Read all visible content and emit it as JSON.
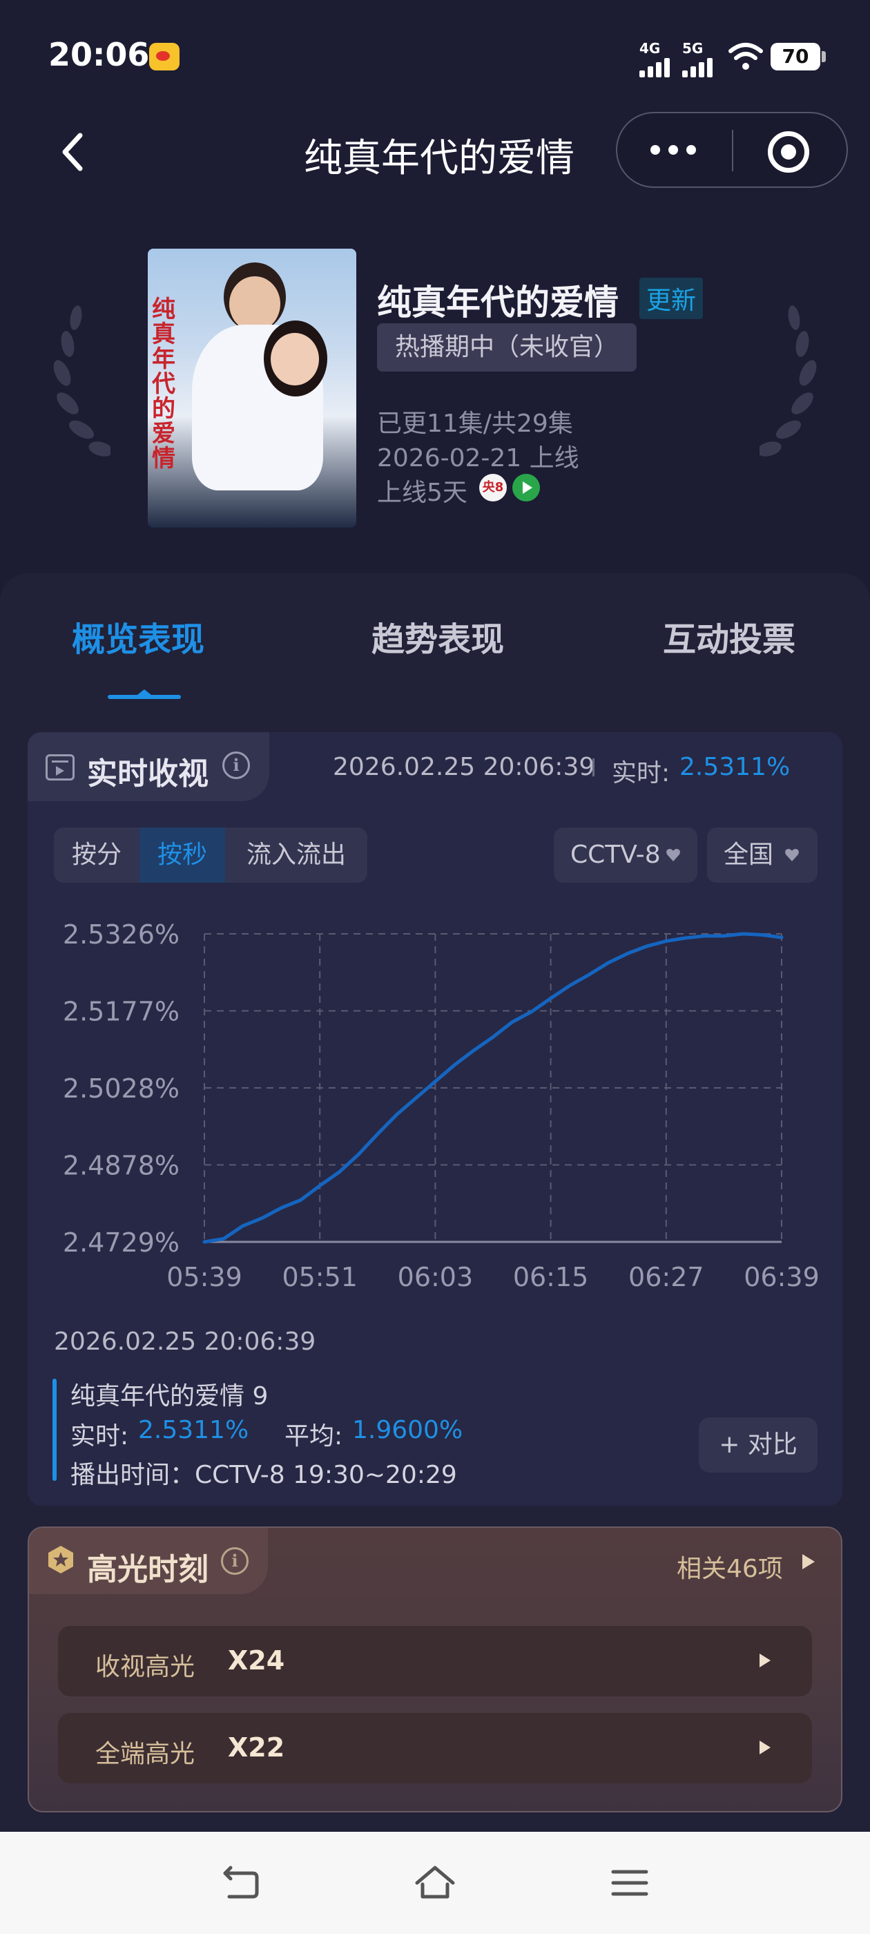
{
  "status_bar": {
    "time": "20:06",
    "network_1": "4G",
    "network_2": "5G",
    "battery": "70"
  },
  "nav": {
    "title": "纯真年代的爱情",
    "back_icon": "chevron-left-icon",
    "more_icon": "more-dots-icon",
    "close_icon": "target-icon"
  },
  "show": {
    "poster_title": "纯真年代的爱情",
    "title": "纯真年代的爱情",
    "update_badge": "更新",
    "status": "热播期中（未收官）",
    "episodes": "已更11集/共29集",
    "premiere": "2026-02-21 上线",
    "days_online": "上线5天",
    "platform_badge": "央8"
  },
  "tabs": [
    {
      "label": "概览表现",
      "active": true
    },
    {
      "label": "趋势表现",
      "active": false
    },
    {
      "label": "互动投票",
      "active": false
    }
  ],
  "realtime": {
    "title": "实时收视",
    "info_glyph": "i",
    "datetime": "2026.02.25 20:06:39",
    "live_label": "实时:",
    "live_value": "2.5311%",
    "segments": [
      "按分",
      "按秒",
      "流入流出"
    ],
    "selected_segment": "按秒",
    "channel": "CCTV-8",
    "region": "全国"
  },
  "chart_data": {
    "type": "line",
    "title": "",
    "xlabel": "",
    "ylabel": "",
    "y_ticks": [
      "2.5326%",
      "2.5177%",
      "2.5028%",
      "2.4878%",
      "2.4729%"
    ],
    "x_ticks": [
      "05:39",
      "05:51",
      "06:03",
      "06:15",
      "06:27",
      "06:39"
    ],
    "ylim": [
      2.4729,
      2.5326
    ],
    "x_unit": "seconds since 20:05:39",
    "grid": true,
    "line_color": "#1565c0",
    "series": [
      {
        "x": [
          0,
          2,
          4,
          6,
          8,
          10,
          12,
          14,
          16,
          18,
          20,
          22,
          24,
          26,
          28,
          30,
          32,
          34,
          36,
          38,
          40,
          42,
          44,
          46,
          48,
          50,
          52,
          54,
          56,
          58,
          60
        ],
        "values": [
          2.4729,
          2.4735,
          2.476,
          2.4775,
          2.4795,
          2.481,
          2.4838,
          2.4864,
          2.4898,
          2.4938,
          2.4976,
          2.5008,
          2.504,
          2.5072,
          2.51,
          2.5126,
          2.5155,
          2.5175,
          2.5201,
          2.5226,
          2.5247,
          2.527,
          2.5288,
          2.5302,
          2.5312,
          2.5318,
          2.5322,
          2.5322,
          2.5326,
          2.5324,
          2.5319
        ]
      }
    ]
  },
  "detail": {
    "time": "2026.02.25 20:06:39",
    "name": "纯真年代的爱情 9",
    "realtime_label": "实时:",
    "realtime_value": "2.5311%",
    "avg_label": "平均:",
    "avg_value": "1.9600%",
    "airtime": "播出时间：CCTV-8 19:30~20:29",
    "compare_button": "+ 对比"
  },
  "highlights": {
    "title": "高光时刻",
    "info_glyph": "i",
    "related": "相关46项",
    "rows": [
      {
        "label": "收视高光",
        "count": "X24"
      },
      {
        "label": "全端高光",
        "count": "X22"
      }
    ]
  },
  "system_nav": {
    "back_icon": "back-icon",
    "home_icon": "home-icon",
    "menu_icon": "menu-icon"
  },
  "colors": {
    "accent": "#1e90e6",
    "background": "#1c1c33",
    "highlight_gold": "#d6bf9a"
  }
}
